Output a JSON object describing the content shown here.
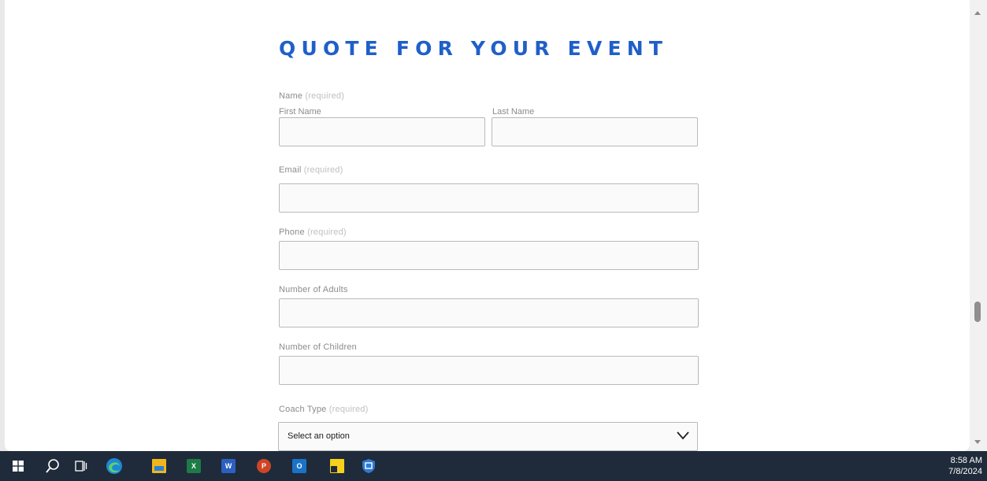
{
  "form": {
    "title": "QUOTE FOR YOUR EVENT",
    "name_label": "Name",
    "name_required": "(required)",
    "first_name_label": "First Name",
    "last_name_label": "Last Name",
    "email_label": "Email",
    "email_required": "(required)",
    "phone_label": "Phone",
    "phone_required": "(required)",
    "adults_label": "Number of Adults",
    "children_label": "Number of Children",
    "coach_type_label": "Coach Type",
    "coach_type_required": "(required)",
    "coach_type_value": "Select an option"
  },
  "taskbar": {
    "icons": [
      "windows-start-icon",
      "search-icon",
      "task-view-icon",
      "edge-icon",
      "file-explorer-icon",
      "excel-icon",
      "word-icon",
      "powerpoint-icon",
      "outlook-icon",
      "sticky-notes-icon",
      "app-icon"
    ],
    "clock": {
      "time": "8:58 AM",
      "date": "7/8/2024"
    }
  },
  "colors": {
    "title": "#1f5fc9",
    "label": "#8b8b8b",
    "required": "#c0c0c0",
    "taskbar": "#1f2b3a"
  }
}
